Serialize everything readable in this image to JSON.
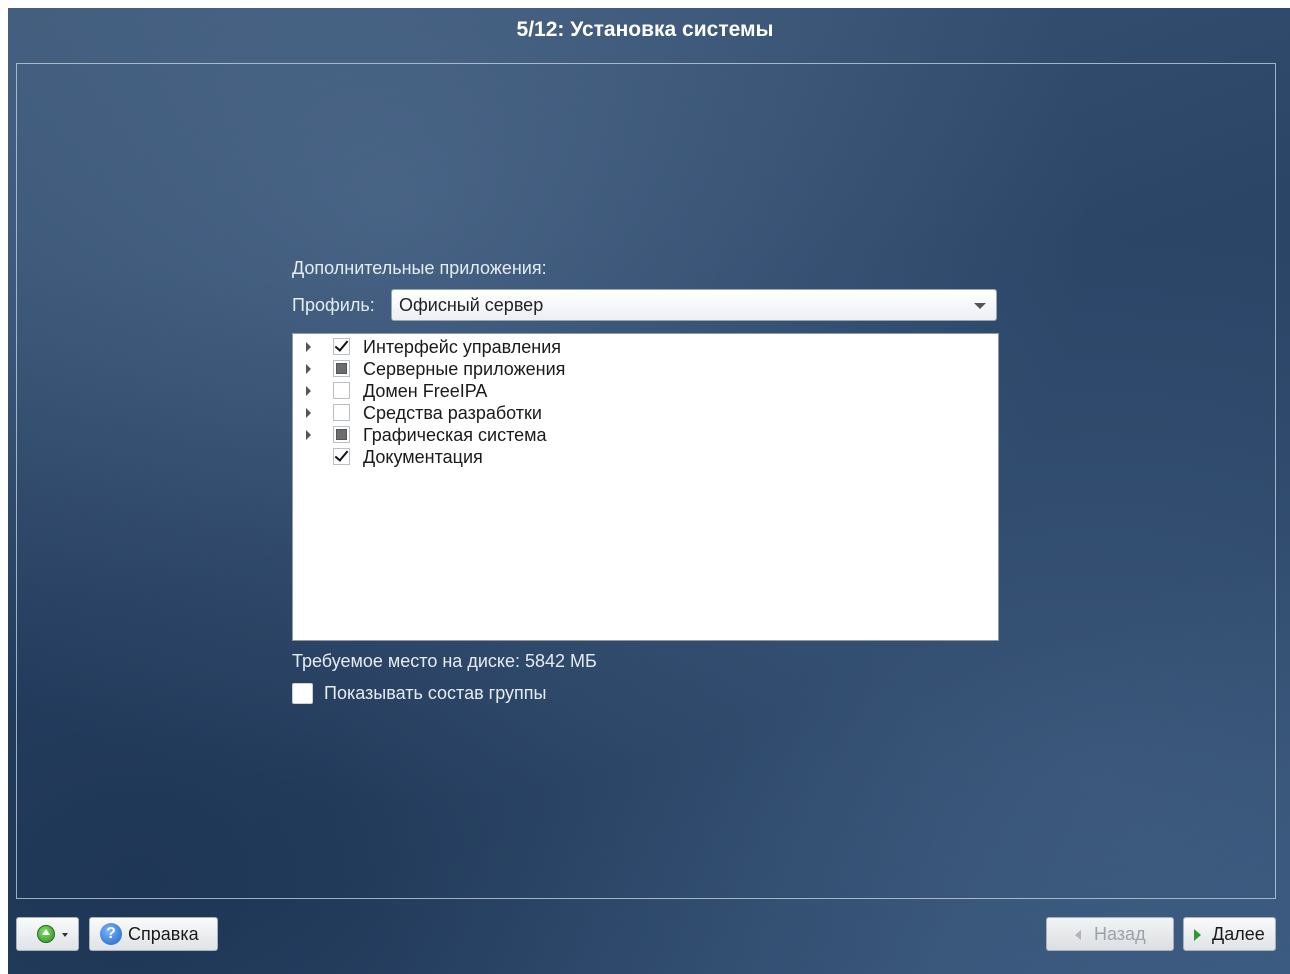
{
  "window": {
    "title": "5/12: Установка системы"
  },
  "main": {
    "section_label": "Дополнительные приложения:",
    "profile_label": "Профиль:",
    "profile_value": "Офисный сервер",
    "groups": [
      {
        "label": "Интерфейс управления",
        "state": "checked",
        "expandable": true
      },
      {
        "label": "Серверные приложения",
        "state": "partial",
        "expandable": true
      },
      {
        "label": "Домен FreeIPA",
        "state": "unchecked",
        "expandable": true
      },
      {
        "label": "Средства разработки",
        "state": "unchecked",
        "expandable": true
      },
      {
        "label": "Графическая система",
        "state": "partial",
        "expandable": true
      },
      {
        "label": "Документация",
        "state": "checked",
        "expandable": false
      }
    ],
    "disk_space": "Требуемое место на диске: 5842 МБ",
    "show_group_label": "Показывать состав группы",
    "show_group_checked": false
  },
  "footer": {
    "menu_icon": "green-up-arrow-icon",
    "help_label": "Справка",
    "help_icon": "question-icon",
    "back_label": "Назад",
    "back_disabled": true,
    "next_label": "Далее"
  }
}
